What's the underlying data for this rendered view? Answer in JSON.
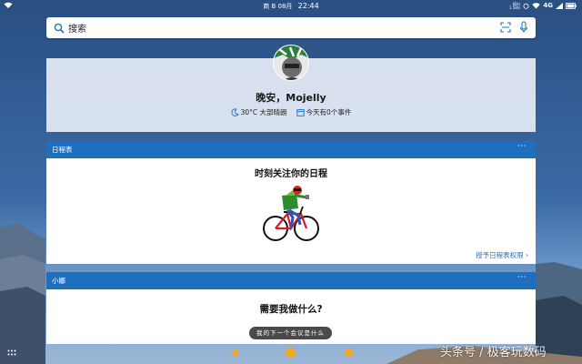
{
  "status_bar": {
    "carrier": "商 B",
    "date": "08月",
    "time": "22:44",
    "speed_up": "0B/s",
    "speed_down": "1.5B/s",
    "network": "4G"
  },
  "search": {
    "placeholder": "搜索",
    "icons": [
      "search-icon",
      "scan-icon",
      "mic-icon"
    ]
  },
  "greeting": {
    "title": "晚安，Mojelly",
    "weather": "30°C 大部晴朗",
    "events": "今天有0个事件"
  },
  "calendar_card": {
    "header": "日程表",
    "more": "···",
    "title": "时刻关注你的日程",
    "grant_link": "授予日程表权限",
    "link_chevron": "›"
  },
  "xiaona_card": {
    "header": "小娜",
    "more": "···",
    "question": "需要我做什么?",
    "suggestion": "我的下一个会议是什么"
  },
  "nav": {
    "icons": [
      "apps-dots-icon",
      "back-icon",
      "home-icon",
      "recent-icon"
    ]
  },
  "watermark": "头条号 / 极客玩数码",
  "colors": {
    "accent": "#1f6fbf",
    "nav_orange": "#f5a623"
  }
}
